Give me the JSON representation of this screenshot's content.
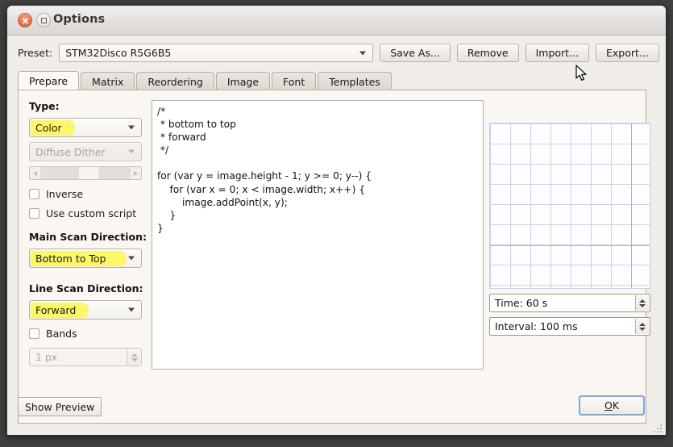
{
  "window": {
    "title": "Options",
    "close_icon": "close-icon",
    "maximize_icon": "maximize-icon"
  },
  "preset": {
    "label": "Preset:",
    "value": "STM32Disco R5G6B5",
    "dropdown_icon": "chevron-down-icon",
    "buttons": [
      {
        "label": "Save As..."
      },
      {
        "label": "Remove"
      },
      {
        "label": "Import..."
      },
      {
        "label": "Export..."
      }
    ]
  },
  "tabs": [
    {
      "label": "Prepare",
      "active": true
    },
    {
      "label": "Matrix",
      "active": false
    },
    {
      "label": "Reordering",
      "active": false
    },
    {
      "label": "Image",
      "active": false
    },
    {
      "label": "Font",
      "active": false
    },
    {
      "label": "Templates",
      "active": false
    }
  ],
  "left_panel": {
    "type_label": "Type:",
    "type_value": "Color",
    "dither_value": "Diffuse Dither",
    "inverse_label": "Inverse",
    "custom_script_label": "Use custom script",
    "main_scan_label": "Main Scan Direction:",
    "main_scan_value": "Bottom to Top",
    "line_scan_label": "Line Scan Direction:",
    "line_scan_value": "Forward",
    "bands_label": "Bands",
    "bands_value": "1 px",
    "highlight_color": "#fcf76a"
  },
  "code": {
    "text": "/*\n * bottom to top\n * forward\n */\n\nfor (var y = image.height - 1; y >= 0; y--) {\n    for (var x = 0; x < image.width; x++) {\n        image.addPoint(x, y);\n    }\n}"
  },
  "right_panel": {
    "grid_name": "preview-grid",
    "grid_line_color": "#c9d1ef",
    "time_value": "Time: 60 s",
    "interval_value": "Interval: 100 ms"
  },
  "footer": {
    "show_preview_label": "Show Preview",
    "ok_label": "OK",
    "ok_mnemonic": "O",
    "ok_rest": "K",
    "focus_color": "#7aa8d8"
  }
}
